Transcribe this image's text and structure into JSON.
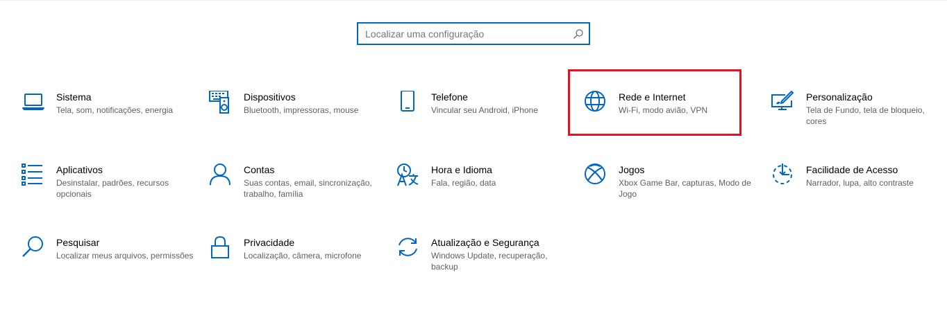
{
  "search": {
    "placeholder": "Localizar uma configuração"
  },
  "accent_color": "#0067c0",
  "highlight_color": "#e81123",
  "tiles": [
    {
      "title": "Sistema",
      "desc": "Tela, som, notificações, energia",
      "icon": "laptop-icon"
    },
    {
      "title": "Dispositivos",
      "desc": "Bluetooth, impressoras, mouse",
      "icon": "devices-icon"
    },
    {
      "title": "Telefone",
      "desc": "Vincular seu Android, iPhone",
      "icon": "phone-icon"
    },
    {
      "title": "Rede e Internet",
      "desc": "Wi-Fi, modo avião, VPN",
      "icon": "globe-icon"
    },
    {
      "title": "Personalização",
      "desc": "Tela de Fundo, tela de bloqueio, cores",
      "icon": "personalization-icon"
    },
    {
      "title": "Aplicativos",
      "desc": "Desinstalar, padrões, recursos opcionais",
      "icon": "apps-list-icon"
    },
    {
      "title": "Contas",
      "desc": "Suas contas, email, sincronização, trabalho, família",
      "icon": "person-icon"
    },
    {
      "title": "Hora e Idioma",
      "desc": "Fala, região, data",
      "icon": "time-language-icon"
    },
    {
      "title": "Jogos",
      "desc": "Xbox Game Bar, capturas, Modo de Jogo",
      "icon": "xbox-icon"
    },
    {
      "title": "Facilidade de Acesso",
      "desc": "Narrador, lupa, alto contraste",
      "icon": "ease-of-access-icon"
    },
    {
      "title": "Pesquisar",
      "desc": "Localizar meus arquivos, permissões",
      "icon": "search-magnifier-icon"
    },
    {
      "title": "Privacidade",
      "desc": "Localização, câmera, microfone",
      "icon": "lock-icon"
    },
    {
      "title": "Atualização e Segurança",
      "desc": "Windows Update, recuperação, backup",
      "icon": "sync-icon"
    }
  ]
}
